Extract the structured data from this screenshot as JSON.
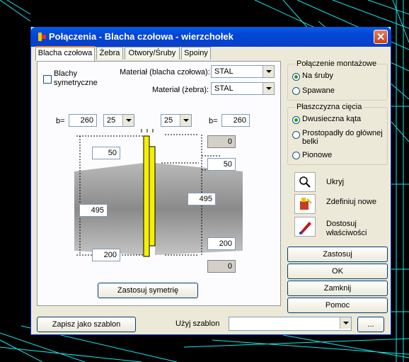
{
  "window": {
    "title": "Połączenia - Blacha czołowa - wierzchołek",
    "close_label": "✕"
  },
  "tabs": [
    "Blacha czołowa",
    "Żebra",
    "Otwory/Śruby",
    "Spoiny"
  ],
  "plate": {
    "symmetric_label_1": "Blachy",
    "symmetric_label_2": "symetryczne",
    "material_plate_label": "Materiał (blacha czołowa):",
    "material_plate_value": "STAL",
    "material_rib_label": "Materiał (żebra):",
    "material_rib_value": "STAL"
  },
  "dims": {
    "b_label": "b=",
    "b_left": "260",
    "combo_left": "25",
    "combo_right": "25",
    "b_right": "260",
    "top_gray": "0",
    "top_left": "50",
    "top_right": "50",
    "mid_left": "495",
    "mid_right": "495",
    "bot_left": "200",
    "bot_right": "200",
    "bot_gray": "0"
  },
  "symmetry_button": "Zastosuj symetrię",
  "mount": {
    "legend": "Połączenie montażowe",
    "options": [
      "Na śruby",
      "Spawane"
    ],
    "selected": 0
  },
  "cut": {
    "legend": "Płaszczyzna cięcia",
    "options": [
      "Dwusieczna kąta",
      "Prostopadły do głównej",
      "belki",
      "Pionowe"
    ],
    "selected": 0
  },
  "actions": {
    "hide": "Ukryj",
    "define": "Zdefiniuj nowe",
    "adjust_1": "Dostosuj",
    "adjust_2": "właściwości"
  },
  "buttons": [
    "Zastosuj",
    "OK",
    "Zamknij",
    "Pomoc"
  ],
  "footer": {
    "save_template": "Zapisz jako szablon",
    "use_template_label": "Użyj szablon",
    "template_value": "",
    "browse": "..."
  }
}
